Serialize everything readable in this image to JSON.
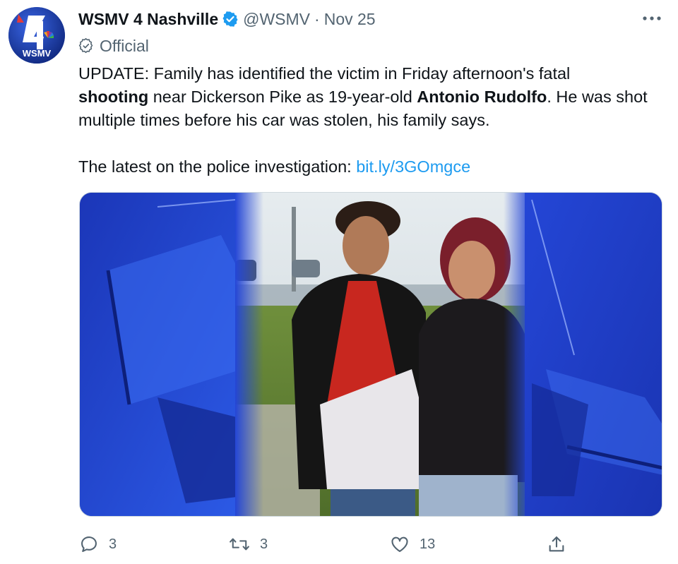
{
  "account": {
    "avatar_text": "WSMV",
    "display_name": "WSMV 4 Nashville",
    "handle": "@WSMV",
    "separator": "·",
    "date": "Nov 25",
    "label": "Official"
  },
  "tweet": {
    "line1": "UPDATE: Family has identified the victim in Friday afternoon's fatal",
    "line2_bold1": "shooting",
    "line2_mid": " near Dickerson Pike as 19-year-old ",
    "line2_bold2": "Antonio Rudolfo",
    "line2_end": ". He was shot",
    "line3": "multiple times before his car was stolen, his family says.",
    "line4": "The latest on the police investigation: ",
    "link": "bit.ly/3GOmgce"
  },
  "actions": {
    "replies": "3",
    "retweets": "3",
    "likes": "13"
  },
  "icons": [
    "verified-badge-icon",
    "more-icon",
    "official-badge-icon",
    "reply-icon",
    "retweet-icon",
    "like-icon",
    "share-icon"
  ],
  "colors": {
    "verified": "#1d9bf0",
    "link": "#1d9bf0",
    "muted": "#536471",
    "brand_blue": "#1b3fb0"
  }
}
